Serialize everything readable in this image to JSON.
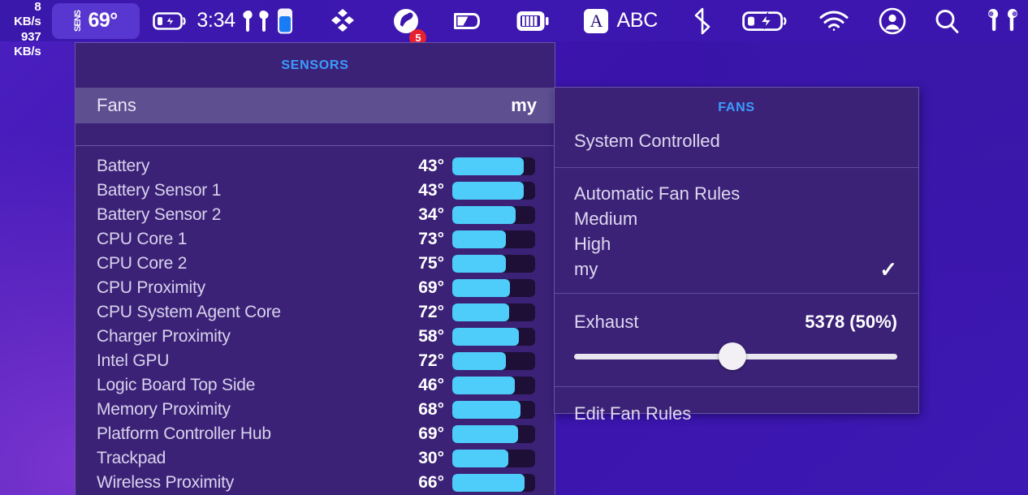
{
  "menubar": {
    "network": {
      "up": "8 KB/s",
      "down": "937 KB/s"
    },
    "sens_badge": {
      "label": "SENS",
      "temp": "69°"
    },
    "clock": "3:34",
    "notification_badge": "5",
    "input_source": "ABC",
    "input_source_glyph": "A",
    "icons": [
      "battery-charging-icon",
      "airpods-icon",
      "battery-level-icon",
      "dropbox-icon",
      "notification-bell-icon",
      "stats-disk-icon",
      "stats-battery-icon",
      "bluetooth-icon",
      "power-charging-icon",
      "wifi-icon",
      "account-icon",
      "search-icon",
      "airpods-pro-icon"
    ]
  },
  "sensors_panel": {
    "title": "SENSORS",
    "fans_row": {
      "label": "Fans",
      "value": "my"
    },
    "rows": [
      {
        "name": "Battery",
        "temp": "43°",
        "fill_pct": 86
      },
      {
        "name": "Battery Sensor 1",
        "temp": "43°",
        "fill_pct": 86
      },
      {
        "name": "Battery Sensor 2",
        "temp": "34°",
        "fill_pct": 76
      },
      {
        "name": "CPU Core 1",
        "temp": "73°",
        "fill_pct": 65
      },
      {
        "name": "CPU Core 2",
        "temp": "75°",
        "fill_pct": 65
      },
      {
        "name": "CPU Proximity",
        "temp": "69°",
        "fill_pct": 70
      },
      {
        "name": "CPU System Agent Core",
        "temp": "72°",
        "fill_pct": 69
      },
      {
        "name": "Charger Proximity",
        "temp": "58°",
        "fill_pct": 80
      },
      {
        "name": "Intel GPU",
        "temp": "72°",
        "fill_pct": 65
      },
      {
        "name": "Logic Board Top Side",
        "temp": "46°",
        "fill_pct": 75
      },
      {
        "name": "Memory Proximity",
        "temp": "68°",
        "fill_pct": 82
      },
      {
        "name": "Platform Controller Hub",
        "temp": "69°",
        "fill_pct": 79
      },
      {
        "name": "Trackpad",
        "temp": "30°",
        "fill_pct": 68
      },
      {
        "name": "Wireless Proximity",
        "temp": "66°",
        "fill_pct": 87
      }
    ]
  },
  "fans_panel": {
    "title": "FANS",
    "system_controlled": "System Controlled",
    "rules": [
      {
        "label": "Automatic Fan Rules",
        "checked": false
      },
      {
        "label": "Medium",
        "checked": false
      },
      {
        "label": "High",
        "checked": false
      },
      {
        "label": "my",
        "checked": true
      }
    ],
    "check_glyph": "✓",
    "exhaust": {
      "label": "Exhaust",
      "value": "5378 (50%)",
      "slider_pct": 49
    },
    "edit_fan_rules": "Edit Fan Rules"
  },
  "colors": {
    "accent_blue": "#3b9dff",
    "bar_fill": "#4ecdfa",
    "panel_bg": "#3b2277",
    "badge_red": "#e8212f"
  }
}
